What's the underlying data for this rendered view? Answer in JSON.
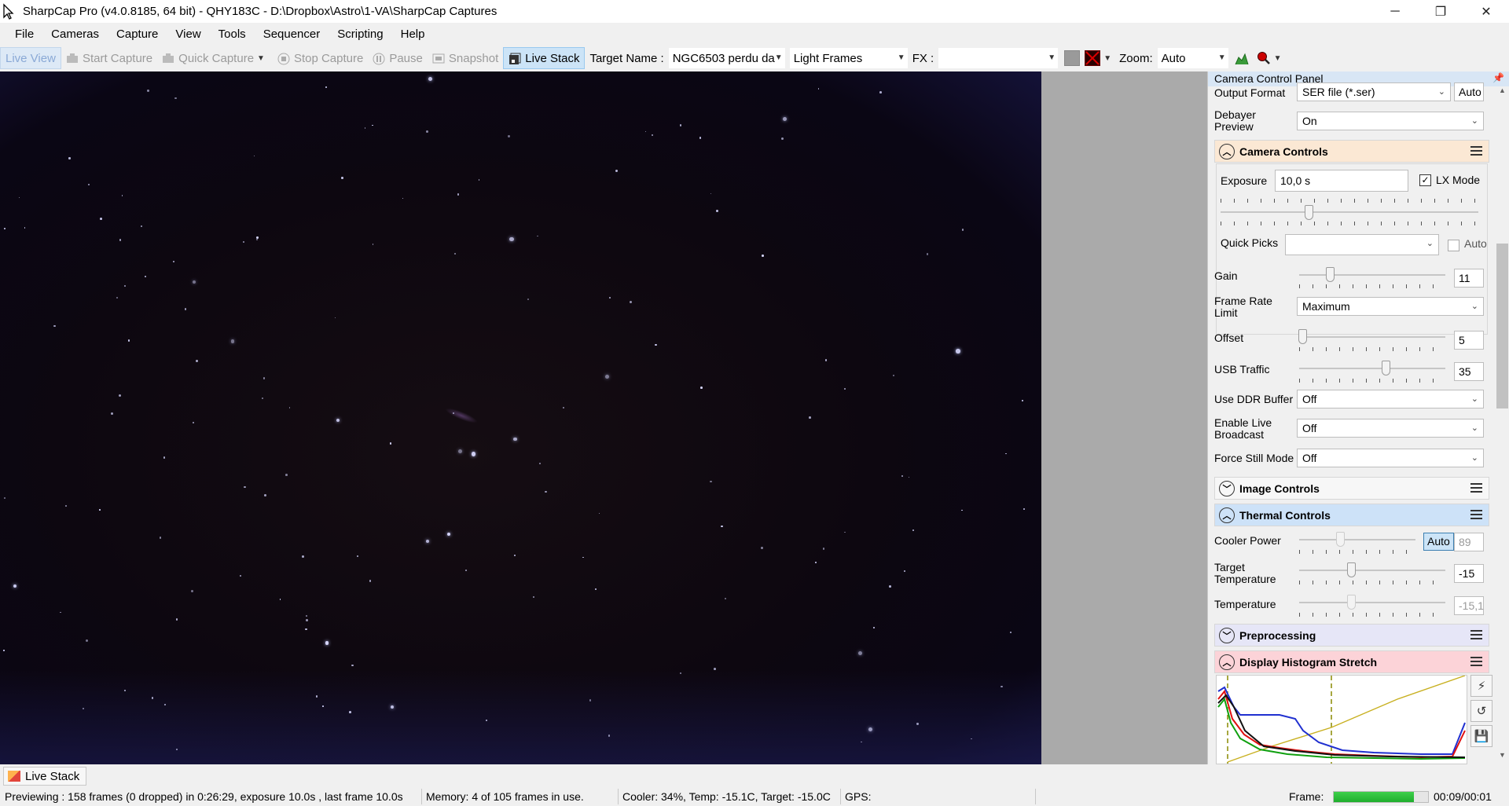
{
  "window": {
    "title": "SharpCap Pro (v4.0.8185, 64 bit) - QHY183C - D:\\Dropbox\\Astro\\1-VA\\SharpCap Captures",
    "minimize": "─",
    "restore": "❐",
    "close": "✕"
  },
  "menu": [
    "File",
    "Cameras",
    "Capture",
    "View",
    "Tools",
    "Sequencer",
    "Scripting",
    "Help"
  ],
  "toolbar": {
    "live_view": "Live View",
    "start_capture": "Start Capture",
    "quick_capture": "Quick Capture",
    "stop_capture": "Stop Capture",
    "pause": "Pause",
    "snapshot": "Snapshot",
    "live_stack": "Live Stack",
    "target_name_label": "Target Name :",
    "target_name_value": "NGC6503 perdu da",
    "frame_type": "Light Frames",
    "fx_label": "FX :",
    "fx_value": "",
    "zoom_label": "Zoom:",
    "zoom_value": "Auto"
  },
  "panel": {
    "title": "Camera Control Panel",
    "output_format_label": "Output Format",
    "output_format_value": "SER file (*.ser)",
    "output_format_auto": "Auto",
    "debayer_label": "Debayer Preview",
    "debayer_value": "On",
    "camera_controls": {
      "title": "Camera Controls",
      "exposure_label": "Exposure",
      "exposure_value": "10,0 s",
      "lx_mode_label": "LX Mode",
      "lx_mode_checked": true,
      "quick_picks_label": "Quick Picks",
      "quick_picks_value": "",
      "quick_picks_auto": "Auto",
      "gain_label": "Gain",
      "gain_value": "11",
      "frame_rate_label": "Frame Rate Limit",
      "frame_rate_value": "Maximum",
      "offset_label": "Offset",
      "offset_value": "5",
      "usb_label": "USB Traffic",
      "usb_value": "35",
      "ddr_label": "Use DDR Buffer",
      "ddr_value": "Off",
      "broadcast_label": "Enable Live Broadcast",
      "broadcast_value": "Off",
      "still_label": "Force Still Mode",
      "still_value": "Off"
    },
    "image_controls_title": "Image Controls",
    "thermal": {
      "title": "Thermal Controls",
      "cooler_label": "Cooler Power",
      "cooler_auto": "Auto",
      "cooler_value": "89",
      "target_label": "Target Temperature",
      "target_value": "-15",
      "temp_label": "Temperature",
      "temp_value": "-15,1"
    },
    "preprocessing_title": "Preprocessing",
    "histogram_title": "Display Histogram Stretch",
    "section_colors": {
      "camera_controls": "#fbe8d4",
      "image_controls": "#f7f7f7",
      "thermal_controls": "#cde2f8",
      "preprocessing": "#e6e6f7",
      "display_histogram": "#fcd3d8"
    }
  },
  "tabs": {
    "live_stack": "Live Stack"
  },
  "status": {
    "previewing": "Previewing : 158 frames (0 dropped) in 0:26:29, exposure 10.0s , last frame 10.0s",
    "memory": "Memory: 4 of 105 frames in use.",
    "cooler": "Cooler: 34%, Temp: -15.1C, Target: -15.0C",
    "gps": "GPS:",
    "frame_label": "Frame:",
    "frame_time": "00:09/00:01",
    "frame_progress": 0.85
  }
}
